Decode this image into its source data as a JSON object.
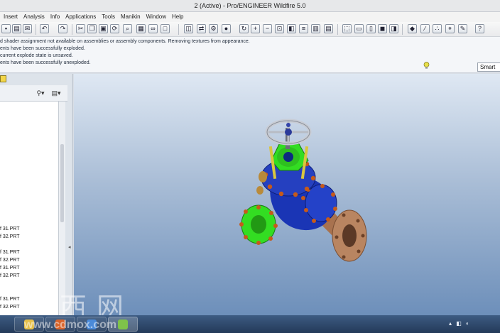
{
  "window": {
    "title": "2 (Active) - Pro/ENGINEER Wildfire 5.0"
  },
  "menu": {
    "items": [
      "Insert",
      "Analysis",
      "Info",
      "Applications",
      "Tools",
      "Manikin",
      "Window",
      "Help"
    ]
  },
  "toolbar": {
    "buttons": [
      "save-icon",
      "print-icon",
      "email-icon",
      "undo-icon",
      "redo-icon",
      "cut-icon",
      "copy-icon",
      "paste-icon",
      "regenerate-icon",
      "find-icon",
      "select-box-icon",
      "repaint-icon",
      "refit-icon",
      "orient-icon",
      "appearance-icon",
      "spin-icon",
      "zoom-in-icon",
      "zoom-out-icon",
      "fit-icon",
      "named-view-icon",
      "layers-icon",
      "view-manager-icon",
      "wireframe-icon",
      "hidden-line-icon",
      "no-hidden-icon",
      "shading-icon",
      "datum-plane-icon",
      "datum-axis-icon",
      "datum-point-icon",
      "csys-icon",
      "help-icon"
    ]
  },
  "messages": {
    "lines": [
      "d shader assignment not available on assemblies or assembly components. Removing textures from appearance.",
      "ents have been successfully exploded.",
      "current explode state is unsaved.",
      "ents have been successfully unexploded."
    ],
    "lightbulb_icon": "lightbulb-icon",
    "filter_value": "Smart"
  },
  "model_tree": {
    "items": [
      "f 31.PRT",
      "f 32.PRT",
      "f 31.PRT",
      "f 32.PRT",
      "f 31.PRT",
      "f 32.PRT",
      "f 31.PRT",
      "f 32.PRT"
    ]
  },
  "watermark": {
    "chars": "莫西网",
    "url": "www.cdmox.com"
  },
  "colors": {
    "viewport_top": "#dfe8f3",
    "viewport_bottom": "#6d8fba",
    "valve_body": "#1a35b5",
    "flange_green": "#33dd22",
    "bolt_orange": "#c65a1a",
    "pipe_bronze": "#b07a55",
    "handwheel": "#c8ccd4",
    "stem_yellow": "#d9c640"
  }
}
